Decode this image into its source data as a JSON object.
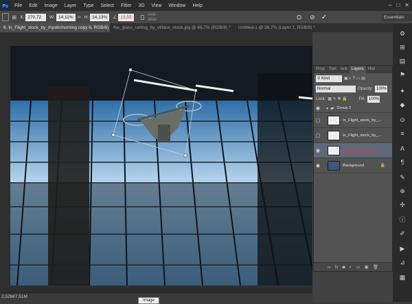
{
  "menubar": {
    "items": [
      "File",
      "Edit",
      "Image",
      "Layer",
      "Type",
      "Select",
      "Filter",
      "3D",
      "View",
      "Window",
      "Help"
    ]
  },
  "options": {
    "x_label": "X:",
    "x_value": "270,72 px",
    "w_label": "W:",
    "w_value": "14,11%",
    "h_label": "H:",
    "h_value": "14,13%",
    "angle_value": "13,55",
    "antialias_label": "Anti-alias",
    "workspace": "Essentials"
  },
  "tabs": [
    {
      "label": "6, In_Flight_stock_by_mysticmorning copy 6, RGB/8) *"
    },
    {
      "label": "the_glass_ceiling_by_stiface_stock.jpg @ 66,7% (RGB/8) *"
    },
    {
      "label": "Untitled-1 @ 36,7% (Layer 1, RGB/8) *"
    }
  ],
  "layers_panel": {
    "tabs": [
      "Prop",
      "Tool",
      "Acti",
      "Layers",
      "Hist"
    ],
    "kind_label": "Kind",
    "blend_mode": "Normal",
    "opacity_label": "Opacity:",
    "opacity_value": "100%",
    "lock_label": "Lock:",
    "fill_label": "Fill:",
    "fill_value": "100%",
    "layers": [
      {
        "name": "Group 2",
        "type": "group"
      },
      {
        "name": "In_Flight_stock_by_...",
        "type": "layer"
      },
      {
        "name": "In_Flight_stock_by_...",
        "type": "layer"
      },
      {
        "name": "In_Flight_stock_by_...",
        "type": "layer",
        "selected": true,
        "name_color": "#e23b3b"
      },
      {
        "name": "Background",
        "type": "background"
      }
    ]
  },
  "status": {
    "doc_size": "2,52M/7,51M",
    "tooltip": "Image"
  },
  "colors": {
    "menubar_bg": "#2c2c2c",
    "panel_bg": "#535353",
    "selected_layer": "#5e6a7a",
    "sky_blue": "#8fb8e0"
  }
}
